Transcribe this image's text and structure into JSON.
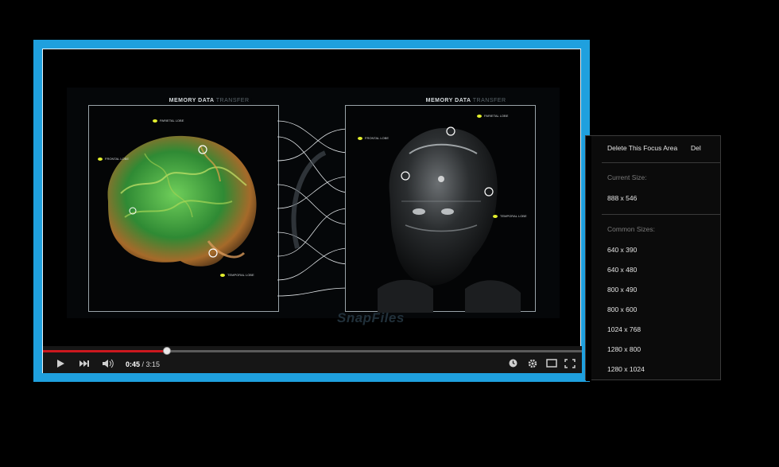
{
  "video": {
    "panel_left_title": "MEMORY DATA",
    "panel_left_title_dim": "TRANSFER",
    "panel_right_title": "MEMORY DATA",
    "panel_right_title_dim": "TRANSFER",
    "watermark": "SnapFiles",
    "labels": [
      "PARIETAL LOBE",
      "FRONTAL LOBE",
      "TEMPORAL LOBE",
      "PARIETAL LOBE",
      "FRONTAL LOBE",
      "TEMPORAL LOBE"
    ]
  },
  "player": {
    "current_time": "0:45",
    "separator": " / ",
    "duration": "3:15",
    "progress": 0.23,
    "play_icon": "play-icon",
    "next_icon": "skip-next-icon",
    "volume_icon": "volume-icon",
    "watch_later_icon": "clock-icon",
    "settings_icon": "gear-icon",
    "theater_icon": "theater-mode-icon",
    "fullscreen_icon": "fullscreen-icon"
  },
  "context_menu": {
    "delete_label": "Delete This Focus Area",
    "delete_shortcut": "Del",
    "current_size_heading": "Current Size:",
    "current_size": "888 x 546",
    "common_sizes_heading": "Common Sizes:",
    "sizes": [
      "640 x 390",
      "640 x 480",
      "800 x 490",
      "800 x 600",
      "1024 x 768",
      "1280 x 800",
      "1280 x 1024"
    ]
  },
  "colors": {
    "focus_border": "#1fa0de",
    "progress_fill": "#cc181e"
  }
}
